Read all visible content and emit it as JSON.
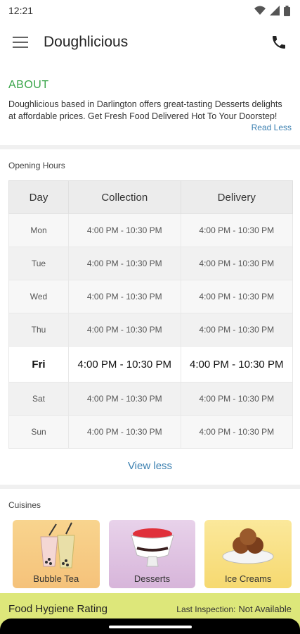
{
  "status": {
    "time": "12:21"
  },
  "appbar": {
    "title": "Doughlicious"
  },
  "about": {
    "heading": "ABOUT",
    "text": "Doughlicious based in Darlington offers great-tasting Desserts delights at affordable prices. Get Fresh Food Delivered Hot To Your Doorstep!",
    "read_less": "Read Less"
  },
  "hours": {
    "title": "Opening Hours",
    "headers": [
      "Day",
      "Collection",
      "Delivery"
    ],
    "rows": [
      {
        "day": "Mon",
        "collection": "4:00 PM - 10:30 PM",
        "delivery": "4:00 PM - 10:30 PM"
      },
      {
        "day": "Tue",
        "collection": "4:00 PM - 10:30 PM",
        "delivery": "4:00 PM - 10:30 PM"
      },
      {
        "day": "Wed",
        "collection": "4:00 PM - 10:30 PM",
        "delivery": "4:00 PM - 10:30 PM"
      },
      {
        "day": "Thu",
        "collection": "4:00 PM - 10:30 PM",
        "delivery": "4:00 PM - 10:30 PM"
      },
      {
        "day": "Fri",
        "collection": "4:00 PM - 10:30 PM",
        "delivery": "4:00 PM - 10:30 PM"
      },
      {
        "day": "Sat",
        "collection": "4:00 PM - 10:30 PM",
        "delivery": "4:00 PM - 10:30 PM"
      },
      {
        "day": "Sun",
        "collection": "4:00 PM - 10:30 PM",
        "delivery": "4:00 PM - 10:30 PM"
      }
    ],
    "view_less": "View less"
  },
  "cuisines": {
    "title": "Cuisines",
    "items": [
      {
        "label": "Bubble Tea",
        "icon": "bubble-tea-icon"
      },
      {
        "label": "Desserts",
        "icon": "dessert-icon"
      },
      {
        "label": "Ice Creams",
        "icon": "ice-cream-icon"
      }
    ]
  },
  "hygiene": {
    "title": "Food Hygiene Rating",
    "last_inspection_label": "Last Inspection:",
    "last_inspection_value": "Not Available"
  },
  "colors": {
    "accent_green": "#3aa54a",
    "link_blue": "#3a7fb0",
    "hygiene_bg": "#dde77a"
  }
}
